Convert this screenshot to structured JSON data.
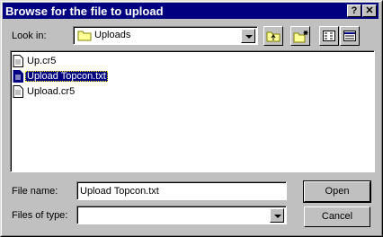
{
  "dialog": {
    "title": "Browse for the file to upload",
    "help_button": "?",
    "close_button": "✕"
  },
  "look_in": {
    "label": "Look in:",
    "value": "Uploads"
  },
  "toolbar": {
    "icons": [
      "up-one-level-icon",
      "create-new-folder-icon",
      "list-view-icon",
      "details-view-icon"
    ]
  },
  "files": [
    {
      "name": "Up.cr5",
      "selected": false
    },
    {
      "name": "Upload Topcon.txt",
      "selected": true
    },
    {
      "name": "Upload.cr5",
      "selected": false
    }
  ],
  "file_name": {
    "label": "File name:",
    "value": "Upload Topcon.txt"
  },
  "files_of_type": {
    "label": "Files of type:",
    "value": ""
  },
  "buttons": {
    "open": "Open",
    "cancel": "Cancel"
  },
  "colors": {
    "titlebar": "#000080",
    "face": "#c0c0c0",
    "selection": "#000080"
  }
}
